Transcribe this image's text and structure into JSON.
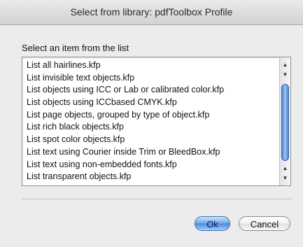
{
  "window": {
    "title": "Select from library: pdfToolbox Profile"
  },
  "dialog": {
    "prompt": "Select an item from the list",
    "items": [
      "List all hairlines.kfp",
      "List invisible text objects.kfp",
      "List objects using ICC or Lab or calibrated color.kfp",
      "List objects using ICCbased CMYK.kfp",
      "List page objects, grouped by type of object.kfp",
      "List rich black objects.kfp",
      "List spot color objects.kfp",
      "List text using Courier inside Trim or BleedBox.kfp",
      "List text using non-embedded fonts.kfp",
      "List transparent objects.kfp"
    ],
    "ok_label": "Ok",
    "cancel_label": "Cancel"
  },
  "scrollbar": {
    "up_arrow": "▲",
    "down_arrow": "▼",
    "icons": [
      "scroll-up-arrow-icon",
      "scroll-down-arrow-icon"
    ]
  },
  "colors": {
    "accent": "#4a88df",
    "background": "#ececec"
  }
}
